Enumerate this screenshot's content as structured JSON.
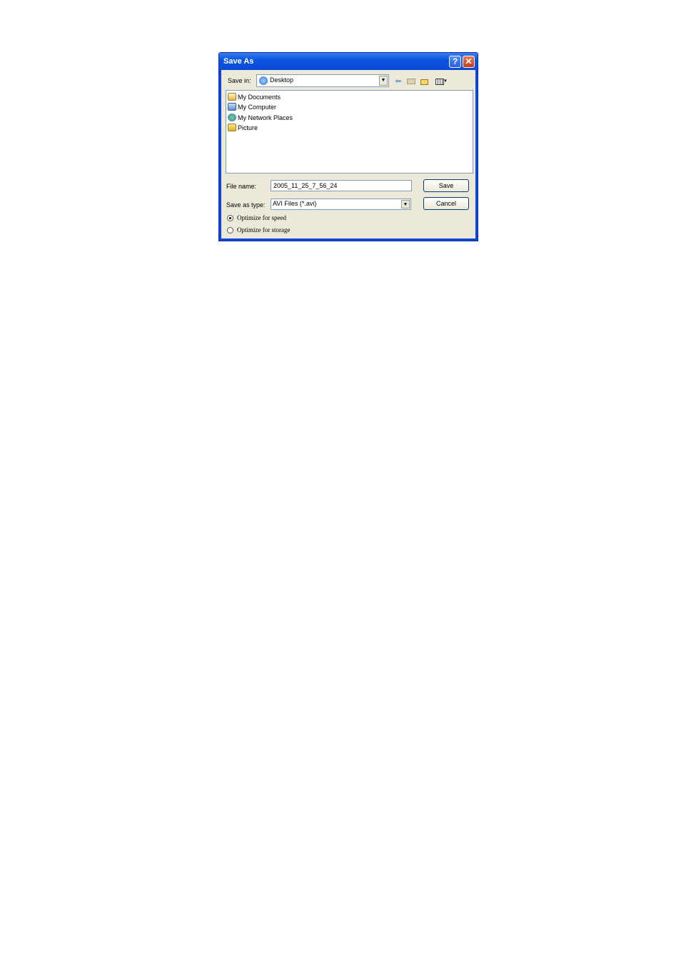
{
  "dialog": {
    "title": "Save As",
    "help_glyph": "?",
    "close_glyph": "✕"
  },
  "save_in": {
    "label": "Save in:",
    "value": "Desktop",
    "icon": "desktop-icon"
  },
  "toolbar": {
    "icons": [
      "back-arrow-icon",
      "up-folder-icon",
      "new-folder-icon",
      "view-menu-icon"
    ]
  },
  "files": [
    {
      "name": "My Documents",
      "icon": "my-documents-icon"
    },
    {
      "name": "My Computer",
      "icon": "my-computer-icon"
    },
    {
      "name": "My Network Places",
      "icon": "network-places-icon"
    },
    {
      "name": "Picture",
      "icon": "folder-icon"
    }
  ],
  "file_name": {
    "label": "File name:",
    "value": "2005_11_25_7_56_24"
  },
  "save_as_type": {
    "label": "Save as type:",
    "value": "AVI Files (*.avi)"
  },
  "buttons": {
    "save": "Save",
    "cancel": "Cancel"
  },
  "options": {
    "speed": "Optimize for speed",
    "storage": "Optimize for storage",
    "selected": "speed"
  }
}
